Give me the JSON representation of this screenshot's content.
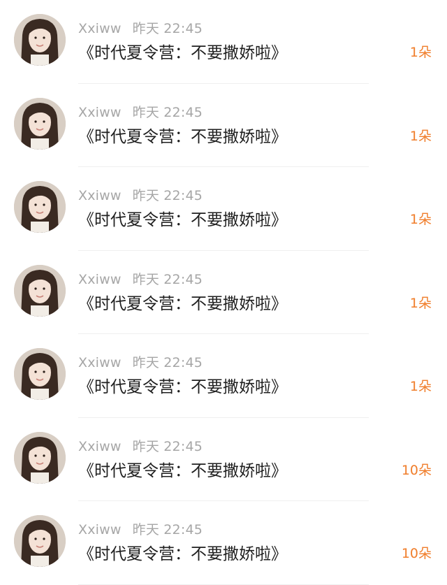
{
  "messages": [
    {
      "user": "Xxiww",
      "time": "昨天 22:45",
      "title": "《时代夏令营：不要撒娇啦》",
      "count": "1朵"
    },
    {
      "user": "Xxiww",
      "time": "昨天 22:45",
      "title": "《时代夏令营：不要撒娇啦》",
      "count": "1朵"
    },
    {
      "user": "Xxiww",
      "time": "昨天 22:45",
      "title": "《时代夏令营：不要撒娇啦》",
      "count": "1朵"
    },
    {
      "user": "Xxiww",
      "time": "昨天 22:45",
      "title": "《时代夏令营：不要撒娇啦》",
      "count": "1朵"
    },
    {
      "user": "Xxiww",
      "time": "昨天 22:45",
      "title": "《时代夏令营：不要撒娇啦》",
      "count": "1朵"
    },
    {
      "user": "Xxiww",
      "time": "昨天 22:45",
      "title": "《时代夏令营：不要撒娇啦》",
      "count": "10朵"
    },
    {
      "user": "Xxiww",
      "time": "昨天 22:45",
      "title": "《时代夏令营：不要撒娇啦》",
      "count": "10朵"
    }
  ],
  "colors": {
    "count_accent": "#f07d2a",
    "meta_gray": "#a6a6a6",
    "title_text": "#1f1f1f"
  }
}
